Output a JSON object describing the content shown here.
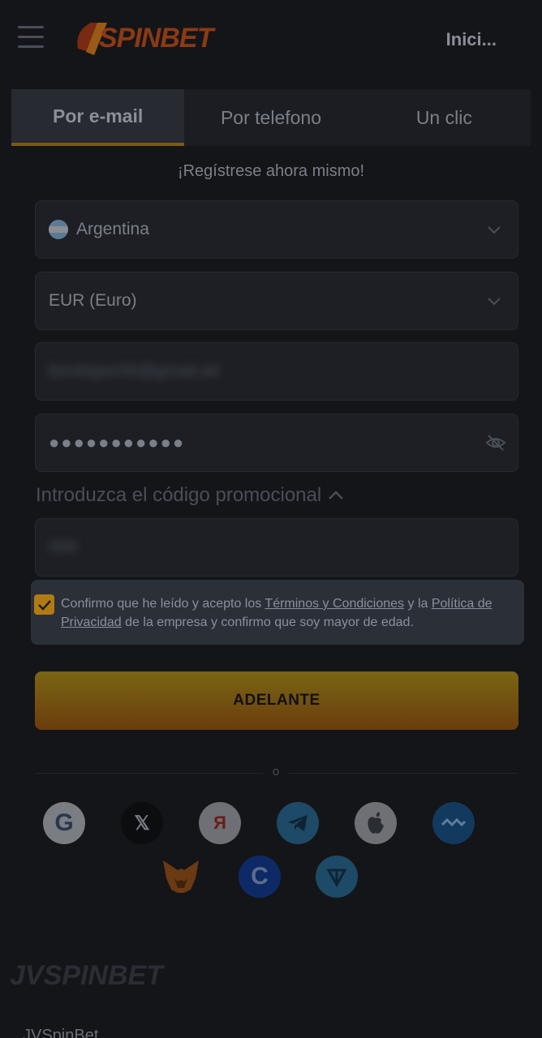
{
  "header": {
    "brand": "JVSPINBET",
    "login_label": "Inici..."
  },
  "tabs": [
    {
      "label": "Por e-mail",
      "active": true
    },
    {
      "label": "Por telefono",
      "active": false
    },
    {
      "label": "Un clic",
      "active": false
    }
  ],
  "form": {
    "subtitle": "¡Regístrese ahora mismo!",
    "country": "Argentina",
    "currency": "EUR (Euro)",
    "email_value": "bonitspor00@gmail.sd",
    "password_mask": "●●●●●●●●●●●",
    "promo_label": "Introduzca el código promocional",
    "promo_value": "000"
  },
  "consent": {
    "text_1": "Confirmo que he leído y acepto los ",
    "terms_link": "Términos y Condiciones",
    "text_2": " y la ",
    "privacy_link_1": "Política de",
    "privacy_link_2": "Privacidad",
    "text_3": " de la empresa y confirmo que soy mayor de edad.",
    "checked": true
  },
  "submit_label": "ADELANTE",
  "divider_label": "o",
  "social": [
    {
      "name": "google-icon",
      "glyph": "G"
    },
    {
      "name": "x-icon",
      "glyph": "𝕏"
    },
    {
      "name": "yandex-icon",
      "glyph": "Я"
    },
    {
      "name": "telegram-icon",
      "glyph": ""
    },
    {
      "name": "apple-icon",
      "glyph": ""
    },
    {
      "name": "wallet-icon",
      "glyph": ""
    },
    {
      "name": "metamask-icon",
      "glyph": ""
    },
    {
      "name": "coinbase-icon",
      "glyph": "C"
    },
    {
      "name": "ton-icon",
      "glyph": ""
    }
  ],
  "footer": {
    "brand": "JVSPINBET",
    "name": "JVSpinBet"
  },
  "colors": {
    "accent": "#b27a12",
    "background": "#141519"
  }
}
